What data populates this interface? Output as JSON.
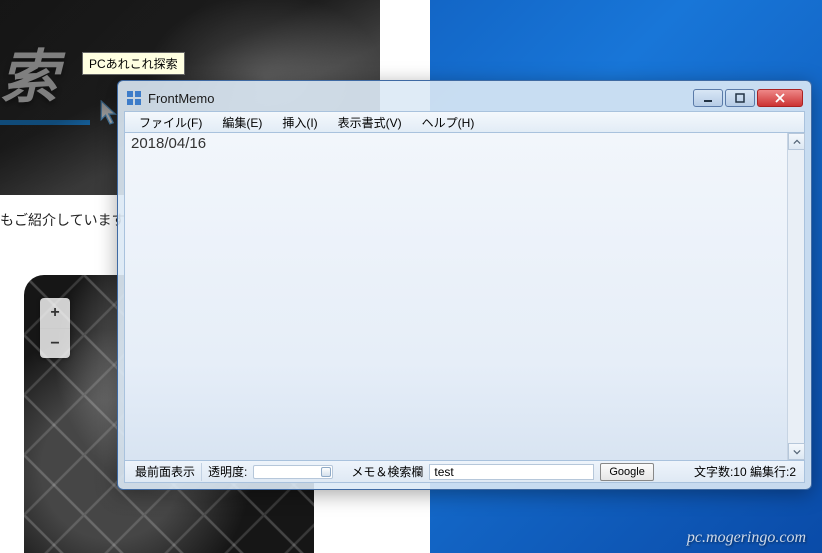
{
  "background": {
    "hero_text": "索",
    "tooltip": "PCあれこれ探索",
    "caption": "もご紹介しています",
    "zoom_in": "+",
    "zoom_out": "−"
  },
  "frontmemo": {
    "title": "FrontMemo",
    "menu": {
      "file": "ファイル(F)",
      "edit": "編集(E)",
      "insert": "挿入(I)",
      "view": "表示書式(V)",
      "help": "ヘルプ(H)"
    },
    "content": "2018/04/16",
    "status": {
      "topmost": "最前面表示",
      "opacity_label": "透明度:",
      "search_label": "メモ＆検索欄",
      "search_value": "test",
      "google_btn": "Google",
      "char_count": "文字数:10 編集行:2"
    }
  },
  "watermark": "pc.mogeringo.com"
}
